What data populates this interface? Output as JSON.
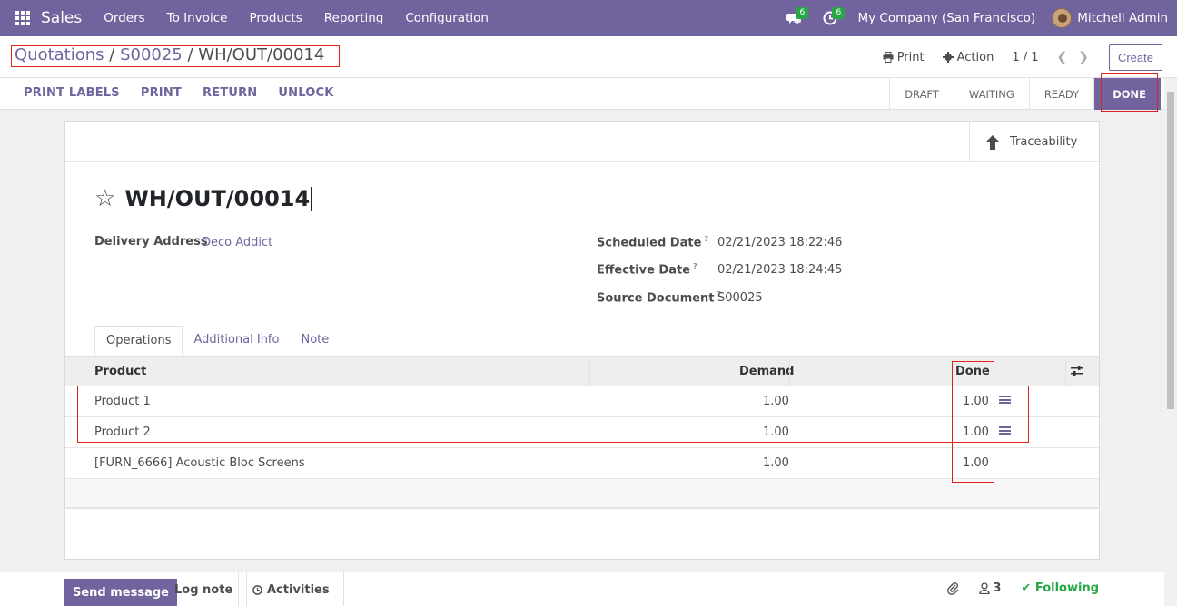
{
  "navbar": {
    "app_name": "Sales",
    "menu": [
      "Orders",
      "To Invoice",
      "Products",
      "Reporting",
      "Configuration"
    ],
    "messages_count": "6",
    "activities_count": "6",
    "company": "My Company (San Francisco)",
    "user": "Mitchell Admin"
  },
  "breadcrumb": {
    "quotations": "Quotations",
    "sep1": " / ",
    "order": "S00025",
    "sep2": " / ",
    "current": "WH/OUT/00014"
  },
  "control": {
    "print_label": "Print",
    "action_label": "Action",
    "pager": "1 / 1",
    "create_label": "Create"
  },
  "statusbar": {
    "actions": [
      "PRINT LABELS",
      "PRINT",
      "RETURN",
      "UNLOCK"
    ],
    "stages": [
      "DRAFT",
      "WAITING",
      "READY",
      "DONE"
    ],
    "active_stage": "DONE"
  },
  "sheet": {
    "traceability_label": "Traceability",
    "title": "WH/OUT/00014",
    "delivery_address_label": "Delivery Address",
    "delivery_address": "Deco Addict",
    "scheduled_date_label": "Scheduled Date",
    "scheduled_date": "02/21/2023 18:22:46",
    "effective_date_label": "Effective Date",
    "effective_date": "02/21/2023 18:24:45",
    "source_document_label": "Source Document",
    "source_document": "S00025",
    "help_mark": "?",
    "tabs": [
      "Operations",
      "Additional Info",
      "Note"
    ]
  },
  "operations": {
    "columns": {
      "product": "Product",
      "demand": "Demand",
      "done": "Done"
    },
    "rows": [
      {
        "product": "Product 1",
        "demand": "1.00",
        "done": "1.00"
      },
      {
        "product": "Product 2",
        "demand": "1.00",
        "done": "1.00"
      },
      {
        "product": "[FURN_6666] Acoustic Bloc Screens",
        "demand": "1.00",
        "done": "1.00"
      }
    ]
  },
  "chatter": {
    "send_message": "Send message",
    "log_note": "Log note",
    "activities": "Activities",
    "followers_count": "3",
    "following": "Following"
  },
  "colors": {
    "brand": "#71639e",
    "highlight": "#e0221f",
    "success": "#28a745"
  }
}
